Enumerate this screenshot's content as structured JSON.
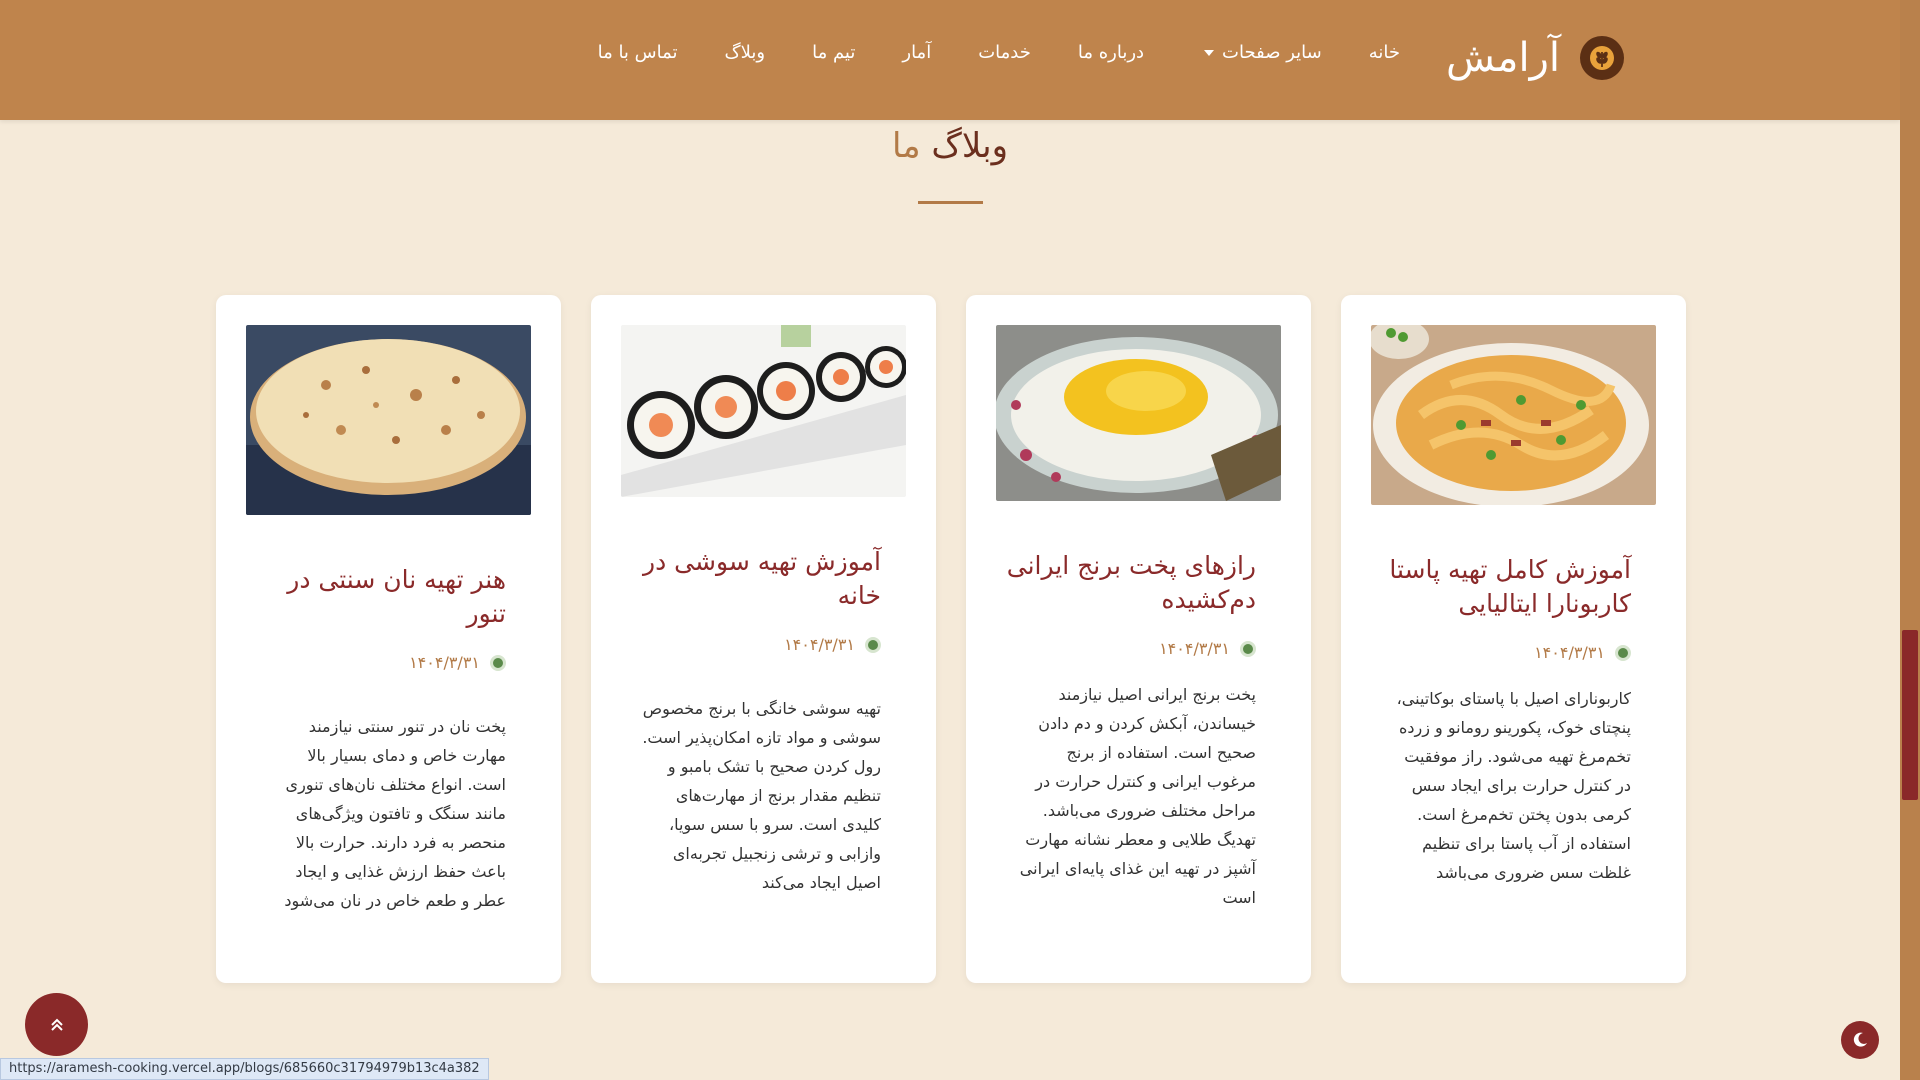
{
  "navbar": {
    "brand": "آرامش",
    "items": [
      {
        "label": "خانه"
      },
      {
        "label": "سایر صفحات"
      },
      {
        "label": "درباره ما"
      },
      {
        "label": "خدمات"
      },
      {
        "label": "آمار"
      },
      {
        "label": "تیم ما"
      },
      {
        "label": "وبلاگ"
      },
      {
        "label": "تماس با ما"
      }
    ],
    "icons": {
      "logo": "wheat-icon",
      "dropdown": "caret-down-icon"
    }
  },
  "section": {
    "title_main": "وبلاگ",
    "title_accent": "ما"
  },
  "blogs": [
    {
      "title": "هنر تهیه نان سنتی در تنور",
      "date": "۱۴۰۴/۳/۳۱",
      "excerpt": "پخت نان در تنور سنتی نیازمند مهارت خاص و دمای بسیار بالا است. انواع مختلف نان‌های تنوری مانند سنگک و تافتون ویژگی‌های منحصر به فرد دارند. حرارت بالا باعث حفظ ارزش غذایی و ایجاد عطر و طعم خاص در نان می‌شود",
      "image": "flatbread"
    },
    {
      "title": "آموزش تهیه سوشی در خانه",
      "date": "۱۴۰۴/۳/۳۱",
      "excerpt": "تهیه سوشی خانگی با برنج مخصوص سوشی و مواد تازه امکان‌پذیر است. رول کردن صحیح با تشک بامبو و تنظیم مقدار برنج از مهارت‌های کلیدی است. سرو با سس سویا، وازابی و ترشی زنجبیل تجربه‌ای اصیل ایجاد می‌کند",
      "image": "sushi"
    },
    {
      "title": "رازهای پخت برنج ایرانی دم‌کشیده",
      "date": "۱۴۰۴/۳/۳۱",
      "excerpt": "پخت برنج ایرانی اصیل نیازمند خیساندن، آبکش کردن و دم دادن صحیح است. استفاده از برنج مرغوب ایرانی و کنترل حرارت در مراحل مختلف ضروری می‌باشد. تهدیگ طلایی و معطر نشانه مهارت آشپز در تهیه این غذای پایه‌ای ایرانی است",
      "image": "saffron-rice"
    },
    {
      "title": "آموزش کامل تهیه پاستا کاربونارا ایتالیایی",
      "date": "۱۴۰۴/۳/۳۱",
      "excerpt": "کاربونارای اصیل با پاستای بوکاتینی، پنچتای خوک، پکورینو رومانو و زرده تخم‌مرغ تهیه می‌شود. راز موفقیت در کنترل حرارت برای ایجاد سس کرمی بدون پختن تخم‌مرغ است. استفاده از آب پاستا برای تنظیم غلظت سس ضروری می‌باشد",
      "image": "pasta"
    }
  ],
  "status_url": "https://aramesh-cooking.vercel.app/blogs/685660c31794979b13c4a382",
  "colors": {
    "header": "#bf844c",
    "page_bg": "#f5ead9",
    "title_dark": "#6b2f1e",
    "accent": "#b27a47",
    "card_title": "#8a2a2a",
    "button": "#8a2929"
  }
}
